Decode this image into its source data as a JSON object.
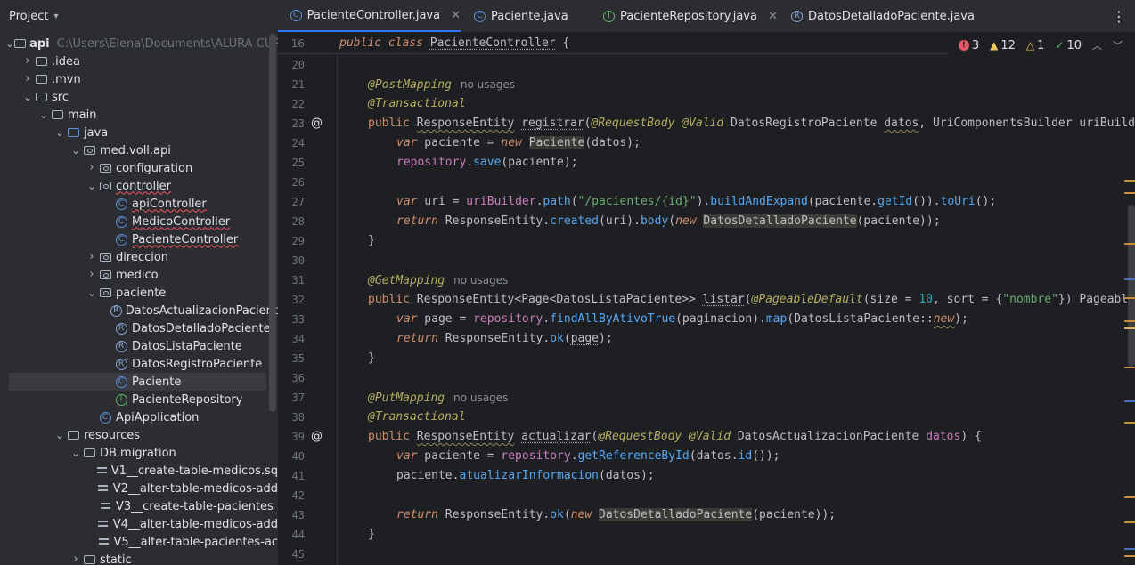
{
  "project": {
    "title": "Project",
    "tree": [
      {
        "label": "api",
        "type": "module",
        "indent": 0,
        "open": true,
        "path": "C:\\Users\\Elena\\Documents\\ALURA CUR"
      },
      {
        "label": ".idea",
        "type": "folder",
        "indent": 1,
        "open": false
      },
      {
        "label": ".mvn",
        "type": "folder",
        "indent": 1,
        "open": false
      },
      {
        "label": "src",
        "type": "folder",
        "indent": 1,
        "open": true
      },
      {
        "label": "main",
        "type": "folder",
        "indent": 2,
        "open": true
      },
      {
        "label": "java",
        "type": "src-folder",
        "indent": 3,
        "open": true
      },
      {
        "label": "med.voll.api",
        "type": "package",
        "indent": 4,
        "open": true
      },
      {
        "label": "configuration",
        "type": "package",
        "indent": 5,
        "open": false
      },
      {
        "label": "controller",
        "type": "package",
        "indent": 5,
        "open": true,
        "error": true
      },
      {
        "label": "apiController",
        "type": "class",
        "indent": 6,
        "error": true
      },
      {
        "label": "MedicoController",
        "type": "class",
        "indent": 6,
        "error": true
      },
      {
        "label": "PacienteController",
        "type": "class",
        "indent": 6,
        "error": true
      },
      {
        "label": "direccion",
        "type": "package",
        "indent": 5,
        "open": false
      },
      {
        "label": "medico",
        "type": "package",
        "indent": 5,
        "open": false
      },
      {
        "label": "paciente",
        "type": "package",
        "indent": 5,
        "open": true
      },
      {
        "label": "DatosActualizacionPacient",
        "type": "record",
        "indent": 6
      },
      {
        "label": "DatosDetalladoPaciente",
        "type": "record",
        "indent": 6
      },
      {
        "label": "DatosListaPaciente",
        "type": "record",
        "indent": 6
      },
      {
        "label": "DatosRegistroPaciente",
        "type": "record",
        "indent": 6
      },
      {
        "label": "Paciente",
        "type": "class",
        "indent": 6,
        "selected": true
      },
      {
        "label": "PacienteRepository",
        "type": "interface",
        "indent": 6
      },
      {
        "label": "ApiApplication",
        "type": "app",
        "indent": 5
      },
      {
        "label": "resources",
        "type": "res-folder",
        "indent": 3,
        "open": true
      },
      {
        "label": "DB.migration",
        "type": "folder",
        "indent": 4,
        "open": true
      },
      {
        "label": "V1__create-table-medicos.sq",
        "type": "file",
        "indent": 5
      },
      {
        "label": "V2__alter-table-medicos-add",
        "type": "file",
        "indent": 5
      },
      {
        "label": "V3__create-table-pacientes",
        "type": "file",
        "indent": 5
      },
      {
        "label": "V4__alter-table-medicos-add",
        "type": "file",
        "indent": 5
      },
      {
        "label": "V5__alter-table-pacientes-ac",
        "type": "file",
        "indent": 5
      },
      {
        "label": "static",
        "type": "folder",
        "indent": 4,
        "open": false
      }
    ]
  },
  "tabs": [
    {
      "label": "PacienteController.java",
      "icon": "class",
      "active": true,
      "closable": true
    },
    {
      "label": "Paciente.java",
      "icon": "class",
      "active": false,
      "closable": false
    },
    {
      "label": "PacienteRepository.java",
      "icon": "interface",
      "active": false,
      "closable": true
    },
    {
      "label": "DatosDetalladoPaciente.java",
      "icon": "record",
      "active": false,
      "closable": false
    }
  ],
  "inspections": {
    "errors": "3",
    "warnings": "12",
    "weak": "1",
    "ok": "10"
  },
  "sticky": {
    "num": "16",
    "code": "public class PacienteController {"
  },
  "editor": {
    "no_usages": "no usages",
    "lines": {
      "l20": "20",
      "l21": "21",
      "l22": "22",
      "l23": "23",
      "l24": "24",
      "l25": "25",
      "l26": "26",
      "l27": "27",
      "l28": "28",
      "l29": "29",
      "l30": "30",
      "l31": "31",
      "l32": "32",
      "l33": "33",
      "l34": "34",
      "l35": "35",
      "l36": "36",
      "l37": "37",
      "l38": "38",
      "l39": "39",
      "l40": "40",
      "l41": "41",
      "l42": "42",
      "l43": "43",
      "l44": "44",
      "l45": "45"
    }
  },
  "colors": {
    "accent": "#3574f0",
    "error": "#e55765",
    "warning": "#f2c55c",
    "ok": "#5fb865"
  }
}
